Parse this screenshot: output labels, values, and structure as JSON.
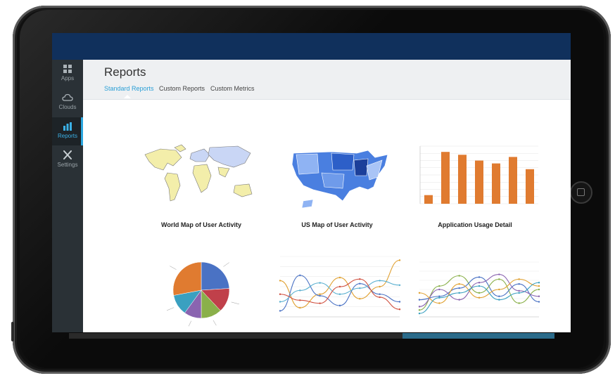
{
  "sidebar": {
    "items": [
      {
        "label": "Apps"
      },
      {
        "label": "Clouds"
      },
      {
        "label": "Reports"
      },
      {
        "label": "Settings"
      }
    ]
  },
  "header": {
    "title": "Reports",
    "tabs": [
      {
        "label": "Standard Reports"
      },
      {
        "label": "Custom Reports"
      },
      {
        "label": "Custom Metrics"
      }
    ]
  },
  "reports": [
    {
      "title": "World Map of User Activity"
    },
    {
      "title": "US Map of User Activity"
    },
    {
      "title": "Application Usage Detail"
    }
  ],
  "colors": {
    "topbar": "#10305c",
    "sidebar": "#2a3136",
    "accent": "#2a9fd6",
    "bar": "#e07b30"
  },
  "chart_data": [
    {
      "type": "bar",
      "title": "Application Usage Detail",
      "values": [
        12,
        72,
        68,
        60,
        56,
        65,
        48
      ],
      "ylim": [
        0,
        80
      ]
    },
    {
      "type": "pie",
      "values": [
        24,
        14,
        12,
        10,
        12,
        28
      ]
    },
    {
      "type": "line",
      "series": [
        {
          "values": [
            48,
            12,
            30,
            52,
            24,
            40,
            75
          ]
        },
        {
          "values": [
            8,
            55,
            28,
            15,
            44,
            30,
            20
          ]
        },
        {
          "values": [
            20,
            35,
            45,
            30,
            38,
            48,
            42
          ]
        },
        {
          "values": [
            30,
            22,
            18,
            40,
            50,
            26,
            10
          ]
        }
      ]
    },
    {
      "type": "line",
      "series": [
        {
          "values": [
            10,
            45,
            60,
            35,
            55,
            20,
            40
          ]
        },
        {
          "values": [
            25,
            30,
            42,
            58,
            30,
            48,
            22
          ]
        },
        {
          "values": [
            15,
            40,
            25,
            50,
            62,
            38,
            30
          ]
        },
        {
          "values": [
            35,
            20,
            48,
            28,
            40,
            55,
            45
          ]
        },
        {
          "values": [
            5,
            28,
            35,
            45,
            25,
            35,
            50
          ]
        }
      ]
    }
  ]
}
